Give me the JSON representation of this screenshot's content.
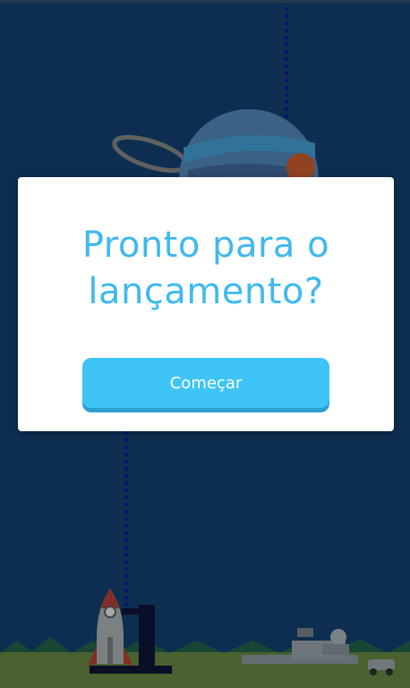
{
  "modal": {
    "title": "Pronto para o lançamento?",
    "start_button_label": "Começar"
  },
  "colors": {
    "background": "#123a66",
    "title": "#3fb9ef",
    "button": "#3ec4f6",
    "button_shadow": "#2c9fd0",
    "ground": "#5d7a3c"
  },
  "icons": {
    "planet": "planet-icon",
    "rocket": "rocket-icon",
    "launch_tower": "launch-tower-icon",
    "space_center": "space-center-icon",
    "rover": "rover-icon"
  }
}
